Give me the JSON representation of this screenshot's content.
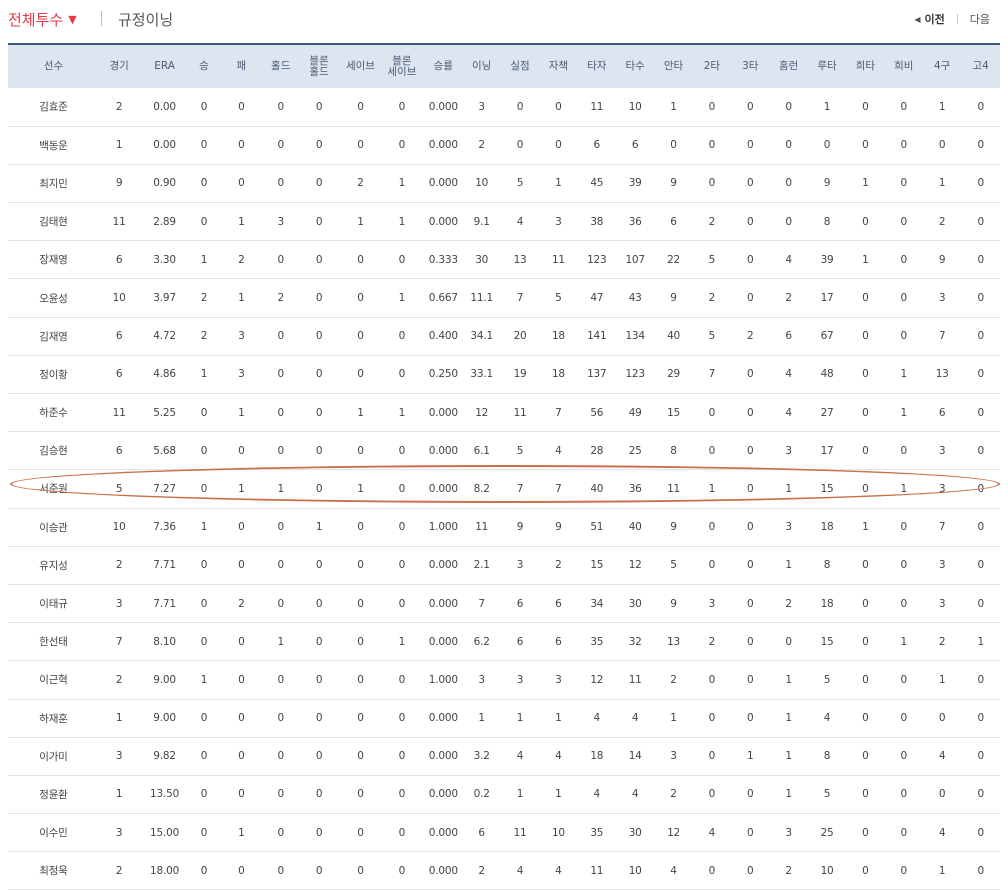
{
  "tabs": {
    "active_label": "전체투수",
    "active_caret": "▼",
    "regular_label": "규정이닝"
  },
  "pager": {
    "prev_icon": "◀",
    "prev_label": "이전",
    "next_label": "다음"
  },
  "table": {
    "headers": [
      [
        "선수"
      ],
      [
        "경기"
      ],
      [
        "ERA"
      ],
      [
        "승"
      ],
      [
        "패"
      ],
      [
        "홀드"
      ],
      [
        "블론",
        "홀드"
      ],
      [
        "세이브"
      ],
      [
        "블론",
        "세이브"
      ],
      [
        "승률"
      ],
      [
        "이닝"
      ],
      [
        "실점"
      ],
      [
        "자책"
      ],
      [
        "타자"
      ],
      [
        "타수"
      ],
      [
        "안타"
      ],
      [
        "2타"
      ],
      [
        "3타"
      ],
      [
        "홈런"
      ],
      [
        "루타"
      ],
      [
        "희타"
      ],
      [
        "희비"
      ],
      [
        "4구"
      ],
      [
        "고4"
      ]
    ],
    "rows": [
      [
        "김효준",
        "2",
        "0.00",
        "0",
        "0",
        "0",
        "0",
        "0",
        "0",
        "0.000",
        "3",
        "0",
        "0",
        "11",
        "10",
        "1",
        "0",
        "0",
        "0",
        "1",
        "0",
        "0",
        "1",
        "0"
      ],
      [
        "백동운",
        "1",
        "0.00",
        "0",
        "0",
        "0",
        "0",
        "0",
        "0",
        "0.000",
        "2",
        "0",
        "0",
        "6",
        "6",
        "0",
        "0",
        "0",
        "0",
        "0",
        "0",
        "0",
        "0",
        "0"
      ],
      [
        "최지민",
        "9",
        "0.90",
        "0",
        "0",
        "0",
        "0",
        "2",
        "1",
        "0.000",
        "10",
        "5",
        "1",
        "45",
        "39",
        "9",
        "0",
        "0",
        "0",
        "9",
        "1",
        "0",
        "1",
        "0"
      ],
      [
        "김태현",
        "11",
        "2.89",
        "0",
        "1",
        "3",
        "0",
        "1",
        "1",
        "0.000",
        "9.1",
        "4",
        "3",
        "38",
        "36",
        "6",
        "2",
        "0",
        "0",
        "8",
        "0",
        "0",
        "2",
        "0"
      ],
      [
        "장재영",
        "6",
        "3.30",
        "1",
        "2",
        "0",
        "0",
        "0",
        "0",
        "0.333",
        "30",
        "13",
        "11",
        "123",
        "107",
        "22",
        "5",
        "0",
        "4",
        "39",
        "1",
        "0",
        "9",
        "0"
      ],
      [
        "오윤성",
        "10",
        "3.97",
        "2",
        "1",
        "2",
        "0",
        "0",
        "1",
        "0.667",
        "11.1",
        "7",
        "5",
        "47",
        "43",
        "9",
        "2",
        "0",
        "2",
        "17",
        "0",
        "0",
        "3",
        "0"
      ],
      [
        "김재영",
        "6",
        "4.72",
        "2",
        "3",
        "0",
        "0",
        "0",
        "0",
        "0.400",
        "34.1",
        "20",
        "18",
        "141",
        "134",
        "40",
        "5",
        "2",
        "6",
        "67",
        "0",
        "0",
        "7",
        "0"
      ],
      [
        "정이황",
        "6",
        "4.86",
        "1",
        "3",
        "0",
        "0",
        "0",
        "0",
        "0.250",
        "33.1",
        "19",
        "18",
        "137",
        "123",
        "29",
        "7",
        "0",
        "4",
        "48",
        "0",
        "1",
        "13",
        "0"
      ],
      [
        "하준수",
        "11",
        "5.25",
        "0",
        "1",
        "0",
        "0",
        "1",
        "1",
        "0.000",
        "12",
        "11",
        "7",
        "56",
        "49",
        "15",
        "0",
        "0",
        "4",
        "27",
        "0",
        "1",
        "6",
        "0"
      ],
      [
        "김승현",
        "6",
        "5.68",
        "0",
        "0",
        "0",
        "0",
        "0",
        "0",
        "0.000",
        "6.1",
        "5",
        "4",
        "28",
        "25",
        "8",
        "0",
        "0",
        "3",
        "17",
        "0",
        "0",
        "3",
        "0"
      ],
      [
        "서준원",
        "5",
        "7.27",
        "0",
        "1",
        "1",
        "0",
        "1",
        "0",
        "0.000",
        "8.2",
        "7",
        "7",
        "40",
        "36",
        "11",
        "1",
        "0",
        "1",
        "15",
        "0",
        "1",
        "3",
        "0"
      ],
      [
        "이승관",
        "10",
        "7.36",
        "1",
        "0",
        "0",
        "1",
        "0",
        "0",
        "1.000",
        "11",
        "9",
        "9",
        "51",
        "40",
        "9",
        "0",
        "0",
        "3",
        "18",
        "1",
        "0",
        "7",
        "0"
      ],
      [
        "유지성",
        "2",
        "7.71",
        "0",
        "0",
        "0",
        "0",
        "0",
        "0",
        "0.000",
        "2.1",
        "3",
        "2",
        "15",
        "12",
        "5",
        "0",
        "0",
        "1",
        "8",
        "0",
        "0",
        "3",
        "0"
      ],
      [
        "이태규",
        "3",
        "7.71",
        "0",
        "2",
        "0",
        "0",
        "0",
        "0",
        "0.000",
        "7",
        "6",
        "6",
        "34",
        "30",
        "9",
        "3",
        "0",
        "2",
        "18",
        "0",
        "0",
        "3",
        "0"
      ],
      [
        "한선태",
        "7",
        "8.10",
        "0",
        "0",
        "1",
        "0",
        "0",
        "1",
        "0.000",
        "6.2",
        "6",
        "6",
        "35",
        "32",
        "13",
        "2",
        "0",
        "0",
        "15",
        "0",
        "1",
        "2",
        "1"
      ],
      [
        "이근혁",
        "2",
        "9.00",
        "1",
        "0",
        "0",
        "0",
        "0",
        "0",
        "1.000",
        "3",
        "3",
        "3",
        "12",
        "11",
        "2",
        "0",
        "0",
        "1",
        "5",
        "0",
        "0",
        "1",
        "0"
      ],
      [
        "하재훈",
        "1",
        "9.00",
        "0",
        "0",
        "0",
        "0",
        "0",
        "0",
        "0.000",
        "1",
        "1",
        "1",
        "4",
        "4",
        "1",
        "0",
        "0",
        "1",
        "4",
        "0",
        "0",
        "0",
        "0"
      ],
      [
        "이가미",
        "3",
        "9.82",
        "0",
        "0",
        "0",
        "0",
        "0",
        "0",
        "0.000",
        "3.2",
        "4",
        "4",
        "18",
        "14",
        "3",
        "0",
        "1",
        "1",
        "8",
        "0",
        "0",
        "4",
        "0"
      ],
      [
        "정윤환",
        "1",
        "13.50",
        "0",
        "0",
        "0",
        "0",
        "0",
        "0",
        "0.000",
        "0.2",
        "1",
        "1",
        "4",
        "4",
        "2",
        "0",
        "0",
        "1",
        "5",
        "0",
        "0",
        "0",
        "0"
      ],
      [
        "이수민",
        "3",
        "15.00",
        "0",
        "1",
        "0",
        "0",
        "0",
        "0",
        "0.000",
        "6",
        "11",
        "10",
        "35",
        "30",
        "12",
        "4",
        "0",
        "3",
        "25",
        "0",
        "0",
        "4",
        "0"
      ],
      [
        "최정욱",
        "2",
        "18.00",
        "0",
        "0",
        "0",
        "0",
        "0",
        "0",
        "0.000",
        "2",
        "4",
        "4",
        "11",
        "10",
        "4",
        "0",
        "0",
        "2",
        "10",
        "0",
        "0",
        "1",
        "0"
      ]
    ],
    "highlighted_row_player": "서준원"
  }
}
